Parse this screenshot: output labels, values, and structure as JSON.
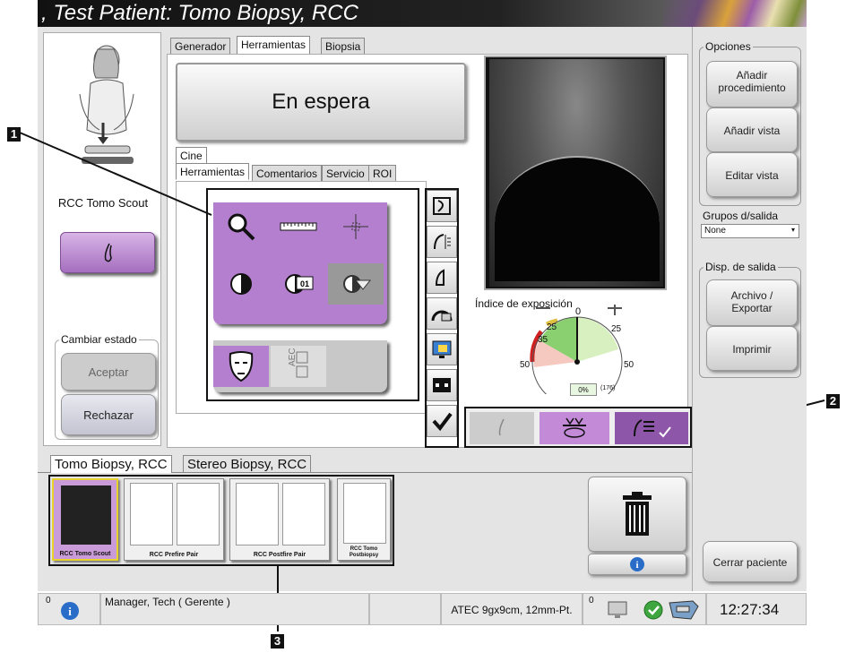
{
  "window": {
    "title": ", Test Patient:  Tomo Biopsy, RCC"
  },
  "left": {
    "view_label": "RCC Tomo Scout",
    "status_group_label": "Cambiar estado",
    "accept_label": "Aceptar",
    "reject_label": "Rechazar"
  },
  "top_tabs": [
    "Generador",
    "Herramientas",
    "Biopsia"
  ],
  "status_display": "En espera",
  "cine_label": "Cine",
  "tool_tabs": [
    "Herramientas",
    "Comentarios",
    "Servicio",
    "ROI"
  ],
  "exposure": {
    "label": "Índice de exposición",
    "marks": [
      "0",
      "25",
      "25",
      "35",
      "50",
      "50"
    ],
    "percent": "0%",
    "extra": "(176)"
  },
  "options": {
    "group_label": "Opciones",
    "add_procedure": "Añadir procedimiento",
    "add_view": "Añadir vista",
    "edit_view": "Editar vista"
  },
  "output_groups": {
    "label": "Grupos d/salida",
    "value": "None"
  },
  "output_devices": {
    "label": "Disp. de salida",
    "archive_export": "Archivo / Exportar",
    "print": "Imprimir"
  },
  "close_patient": "Cerrar paciente",
  "procedure_tabs": [
    "Tomo Biopsy, RCC",
    "Stereo Biopsy, RCC"
  ],
  "thumbnails": [
    "RCC Tomo Scout",
    "RCC Prefire Pair",
    "RCC Postfire Pair",
    "RCC Tomo Postbiopsy"
  ],
  "status_bar": {
    "count_left": "0",
    "user": "Manager, Tech ( Gerente )",
    "paddle": "ATEC 9gx9cm, 12mm-Pt.",
    "count_right": "0",
    "time": "12:27:34"
  },
  "callouts": [
    "1",
    "2",
    "3"
  ],
  "colors": {
    "accent_purple": "#b57fcf",
    "title_bg": "#111111"
  }
}
